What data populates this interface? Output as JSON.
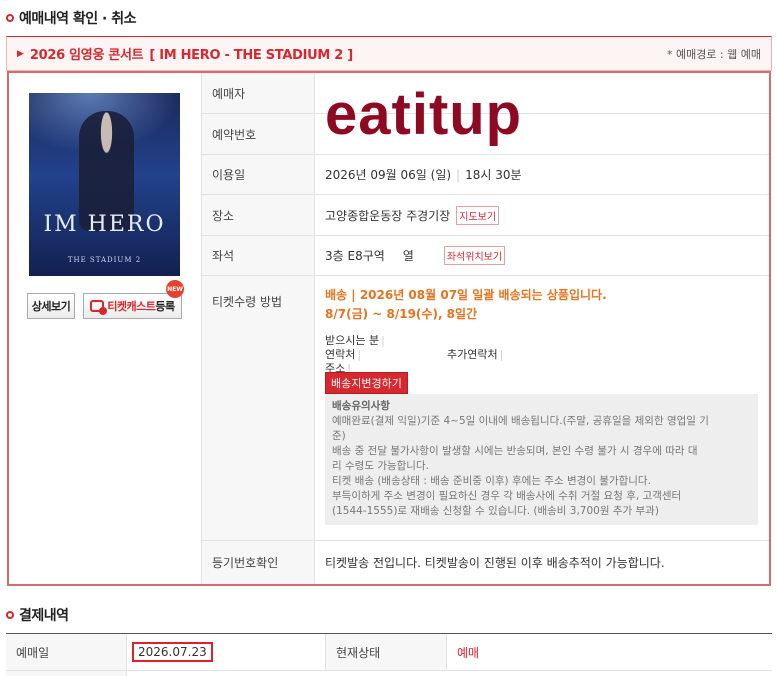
{
  "section1": {
    "title": "예매내역 확인 · 취소"
  },
  "concert": {
    "title_year": "2026 임영웅 콘서트",
    "title_name": "[ IM HERO - THE STADIUM 2 ]",
    "route": "* 예매경로 : 웹 예매"
  },
  "poster": {
    "title": "IM HERO",
    "subtitle": "THE STADIUM 2"
  },
  "buttons": {
    "detail": "상세보기",
    "cast_red": "티켓캐스트",
    "cast_black": "등록",
    "new_badge": "NEW"
  },
  "watermark": "eatitup",
  "rows": {
    "booker": {
      "label": "예매자",
      "value": ""
    },
    "booking_no": {
      "label": "예약번호",
      "value": ""
    },
    "use_date": {
      "label": "이용일",
      "date": "2026년 09월 06일 (일)",
      "time": "18시 30분"
    },
    "venue": {
      "label": "장소",
      "value": "고양종합운동장 주경기장",
      "map_btn": "지도보기"
    },
    "seat": {
      "label": "좌석",
      "floor": "3층 E8구역",
      "col": "열",
      "seat_btn": "좌석위치보기"
    },
    "delivery": {
      "label": "티켓수령 방법",
      "headline": "배송 | 2026년 08월 07일 일괄 배송되는 상품입니다.",
      "period": "8/7(금) ~ 8/19(수), 8일간",
      "recipient": "받으시는 분",
      "contact": "연락처",
      "extra_contact": "추가연락처",
      "address": "주소",
      "change_btn": "배송지변경하기",
      "notice_title": "배송유의사항",
      "notice_lines": [
        "예매완료(결제 익일)기준 4~5일 이내에 배송됩니다.(주말, 공휴일을 제외한 영업일 기",
        "준)",
        "배송 중 전달 불가사항이 발생할 시에는 반송되며, 본인 수령 불가 시 경우에 따라 대",
        "리 수령도 가능합니다.",
        "티켓 배송 (배송상태 : 배송 준비중 이후) 후에는 주소 변경이 불가합니다.",
        "부득이하게 주소 변경이 필요하신 경우 각 배송사에 수취 거절 요청 후, 고객센터",
        "(1544-1555)로 재배송 신청할 수 있습니다. (배송비 3,700원 추가 부과)"
      ]
    },
    "registered": {
      "label": "등기번호확인",
      "value": "티켓발송 전입니다. 티켓발송이 진행된 이후 배송추적이 가능합니다."
    }
  },
  "section2": {
    "title": "결제내역"
  },
  "payment": {
    "date_label": "예매일",
    "date_value": "2026.07.23",
    "status_label": "현재상태",
    "status_value": "예매"
  }
}
